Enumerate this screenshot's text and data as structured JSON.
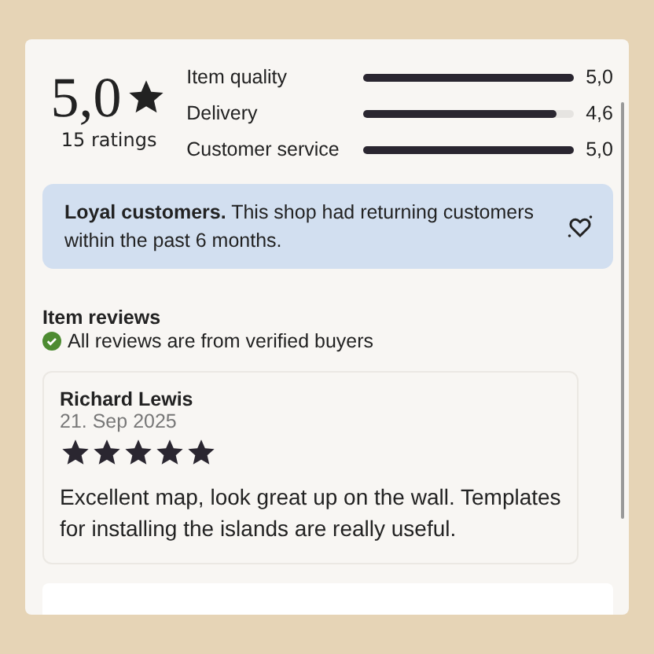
{
  "summary": {
    "score": "5,0",
    "ratings_count": "15 ratings"
  },
  "categories": [
    {
      "label": "Item quality",
      "level": 1,
      "value": "5,0"
    },
    {
      "label": "Delivery",
      "level": 0.92,
      "value": "4,6"
    },
    {
      "label": "Customer service",
      "level": 1,
      "value": "5,0"
    }
  ],
  "banner": {
    "text": "**Loyal customers.** This shop had returning customers within the past 6 months."
  },
  "reviews_section": {
    "title": "Item reviews",
    "verified_note": "All reviews are from verified buyers"
  },
  "reviews": [
    {
      "author": "Richard Lewis",
      "date": "21. Sep 2025",
      "stars": 5,
      "text": "Excellent map, look great up on the wall.  Templates for installing the islands are really useful."
    }
  ]
}
